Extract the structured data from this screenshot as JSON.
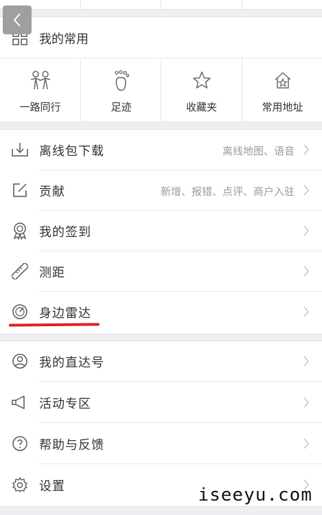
{
  "favorites": {
    "title": "我的常用",
    "items": [
      {
        "label": "一路同行",
        "icon": "people-together-icon"
      },
      {
        "label": "足迹",
        "icon": "footprint-icon"
      },
      {
        "label": "收藏夹",
        "icon": "star-icon"
      },
      {
        "label": "常用地址",
        "icon": "home-star-icon"
      }
    ]
  },
  "menu1": [
    {
      "label": "离线包下载",
      "sub": "离线地图、语音",
      "icon": "download-tray-icon"
    },
    {
      "label": "贡献",
      "sub": "新增、报错、点评、商户入驻",
      "icon": "edit-icon"
    },
    {
      "label": "我的签到",
      "sub": "",
      "icon": "medal-icon"
    },
    {
      "label": "测距",
      "sub": "",
      "icon": "ruler-icon"
    },
    {
      "label": "身边雷达",
      "sub": "",
      "icon": "radar-icon"
    }
  ],
  "menu2": [
    {
      "label": "我的直达号",
      "sub": "",
      "icon": "user-circle-icon"
    },
    {
      "label": "活动专区",
      "sub": "",
      "icon": "megaphone-icon"
    },
    {
      "label": "帮助与反馈",
      "sub": "",
      "icon": "help-circle-icon"
    },
    {
      "label": "设置",
      "sub": "",
      "icon": "gear-icon"
    }
  ],
  "watermark": "iseeyu.com",
  "colors": {
    "highlight": "#e02020",
    "subtext": "#9a9a9a",
    "background": "#efeef3"
  }
}
